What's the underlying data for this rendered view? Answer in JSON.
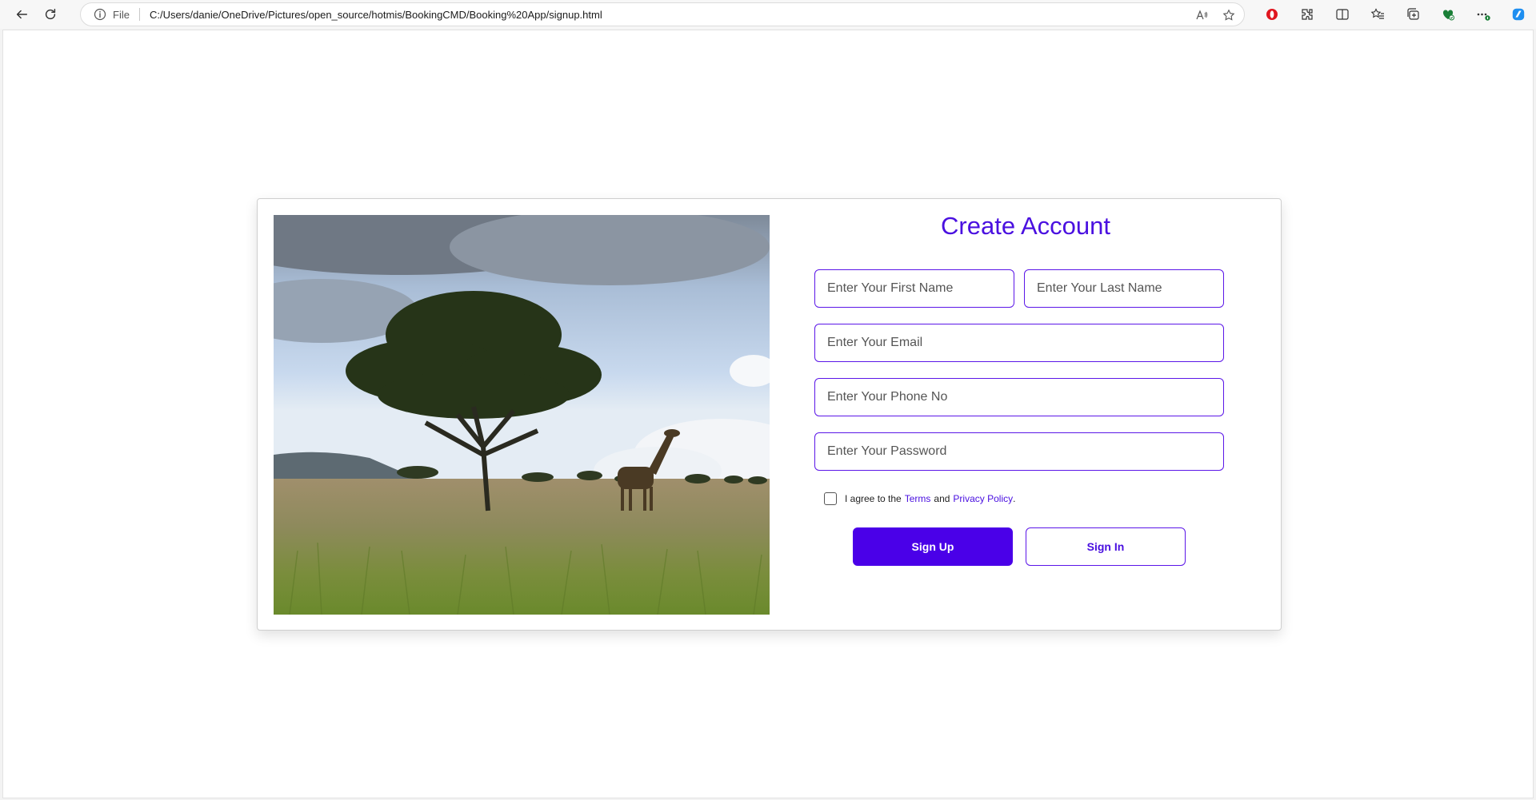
{
  "browser": {
    "file_label": "File",
    "url": "C:/Users/danie/OneDrive/Pictures/open_source/hotmis/BookingCMD/Booking%20App/signup.html",
    "extensions": [
      "opera-icon",
      "extensions-icon",
      "split-screen-icon",
      "favorites-icon",
      "collections-icon",
      "browser-essentials-icon",
      "more-icon",
      "copilot-icon"
    ]
  },
  "signup": {
    "title": "Create Account",
    "first_name_placeholder": "Enter Your First Name",
    "last_name_placeholder": "Enter Your Last Name",
    "email_placeholder": "Enter Your Email",
    "phone_placeholder": "Enter Your Phone No",
    "password_placeholder": "Enter Your Password",
    "agree_prefix": "I agree to the",
    "terms_link": "Terms",
    "agree_and": "and",
    "privacy_link": "Privacy Policy",
    "agree_suffix": ".",
    "signup_button": "Sign Up",
    "signin_button": "Sign In"
  },
  "colors": {
    "accent": "#4a10e0",
    "button_primary": "#4a00e8"
  }
}
